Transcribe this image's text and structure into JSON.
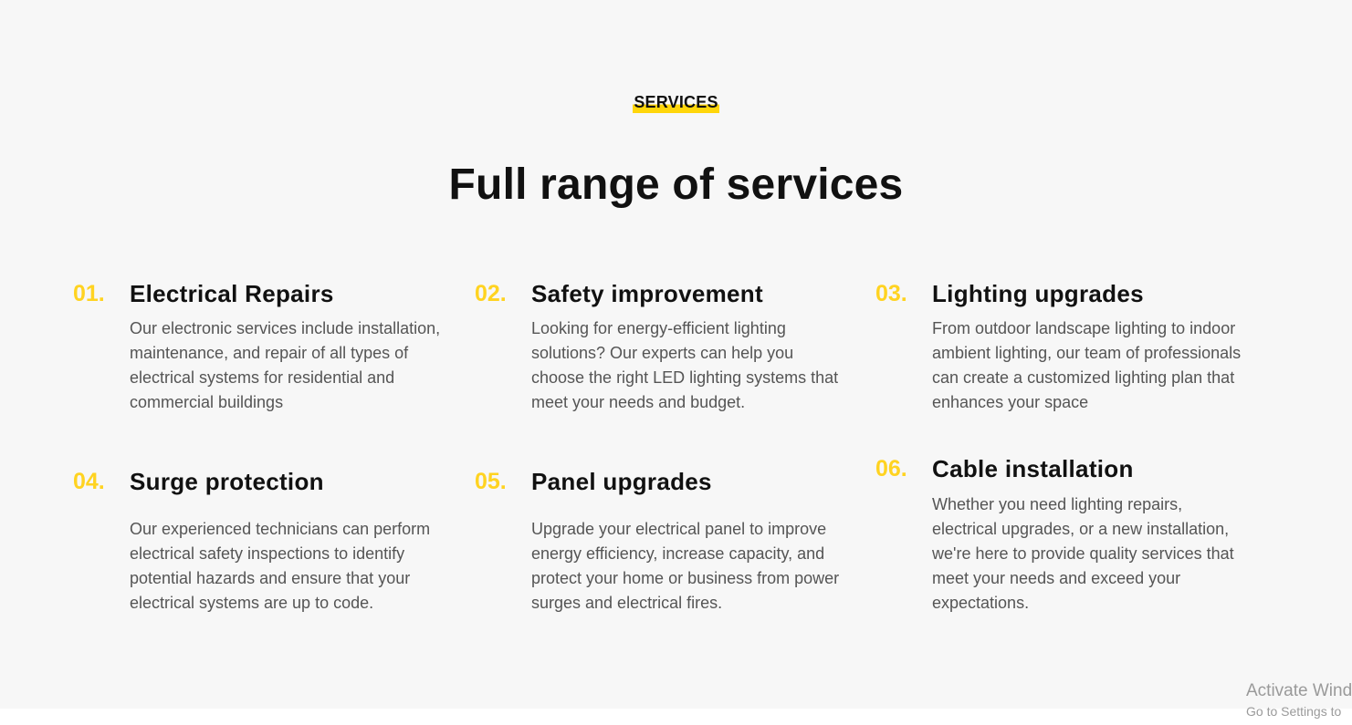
{
  "section": {
    "eyebrow": "SERVICES",
    "title": "Full range of services"
  },
  "services": [
    {
      "number": "01.",
      "title": "Electrical Repairs",
      "description": "Our electronic services include installation, maintenance, and repair of all types of electrical systems for residential and commercial buildings"
    },
    {
      "number": "02.",
      "title": "Safety improvement",
      "description": "Looking for energy-efficient lighting solutions? Our experts can help you choose the right LED lighting systems that meet your needs and budget."
    },
    {
      "number": "03.",
      "title": "Lighting upgrades",
      "description": "From outdoor landscape lighting to indoor ambient lighting, our team of professionals can create a customized lighting plan that enhances your space"
    },
    {
      "number": "04.",
      "title": "Surge protection",
      "description": "Our experienced technicians can perform electrical safety inspections to identify potential hazards and ensure that your electrical systems are up to code."
    },
    {
      "number": "05.",
      "title": "Panel upgrades",
      "description": "Upgrade your electrical panel to improve energy efficiency, increase capacity, and protect your home or business from power surges and electrical fires."
    },
    {
      "number": "06.",
      "title": "Cable installation",
      "description": "Whether you need lighting repairs, electrical upgrades, or a new installation, we're here to provide quality services that meet your needs and exceed your expectations."
    }
  ],
  "watermark": {
    "line1": "Activate Wind",
    "line2": "Go to Settings to"
  },
  "colors": {
    "accent": "#ffd321",
    "background": "#f7f7f7",
    "heading": "#111111",
    "body_text": "#555555"
  }
}
